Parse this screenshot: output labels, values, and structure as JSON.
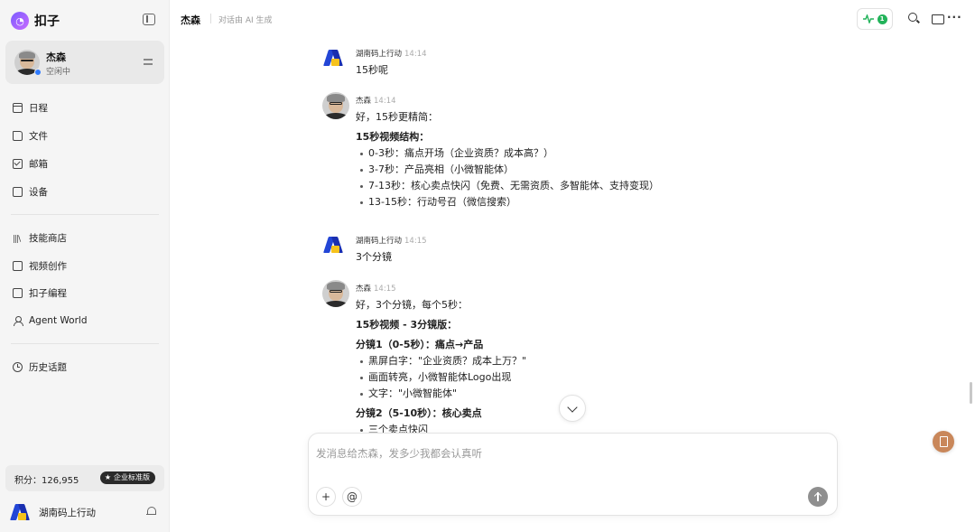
{
  "app": {
    "name": "扣子"
  },
  "profile": {
    "name": "杰森",
    "status": "空闲中"
  },
  "nav": {
    "group1": [
      {
        "label": "日程",
        "icon": "calendar-icon"
      },
      {
        "label": "文件",
        "icon": "folder-icon"
      },
      {
        "label": "邮箱",
        "icon": "mail-icon"
      },
      {
        "label": "设备",
        "icon": "device-icon"
      }
    ],
    "group2": [
      {
        "label": "技能商店",
        "icon": "library-icon"
      },
      {
        "label": "视频创作",
        "icon": "video-icon"
      },
      {
        "label": "扣子编程",
        "icon": "code-icon"
      },
      {
        "label": "Agent World",
        "icon": "person-icon"
      }
    ],
    "group3": [
      {
        "label": "历史话题",
        "icon": "history-icon"
      }
    ]
  },
  "points": {
    "text": "积分：126,955",
    "badge": "企业标准版"
  },
  "team": {
    "name": "湖南码上行动"
  },
  "header": {
    "title": "杰森",
    "subtitle": "对话由 AI 生成",
    "activity_count": "1"
  },
  "messages": [
    {
      "sender": "湖南码上行动",
      "time": "14:14",
      "role": "user",
      "lines": [
        "15秒呢"
      ]
    },
    {
      "sender": "杰森",
      "time": "14:14",
      "role": "assistant",
      "intro": "好，15秒更精简：",
      "heading": "15秒视频结构：",
      "items": [
        "0-3秒：痛点开场（企业资质？成本高？）",
        "3-7秒：产品亮相（小微智能体）",
        "7-13秒：核心卖点快闪（免费、无需资质、多智能体、支持变现）",
        "13-15秒：行动号召（微信搜索）"
      ]
    },
    {
      "sender": "湖南码上行动",
      "time": "14:15",
      "role": "user",
      "lines": [
        "3个分镜"
      ]
    },
    {
      "sender": "杰森",
      "time": "14:15",
      "role": "assistant",
      "intro": "好，3个分镜，每个5秒：",
      "heading": "15秒视频 - 3分镜版：",
      "section1_title": "分镜1（0-5秒）：痛点→产品",
      "section1_items": [
        "黑屏白字：\"企业资质？成本上万？\"",
        "画面转亮，小微智能体Logo出现",
        "文字：\"小微智能体\""
      ],
      "section2_title": "分镜2（5-10秒）：核心卖点",
      "section2_items": [
        "三个卖点快闪"
      ]
    }
  ],
  "composer": {
    "placeholder": "发消息给杰森，发多少我都会认真听"
  }
}
